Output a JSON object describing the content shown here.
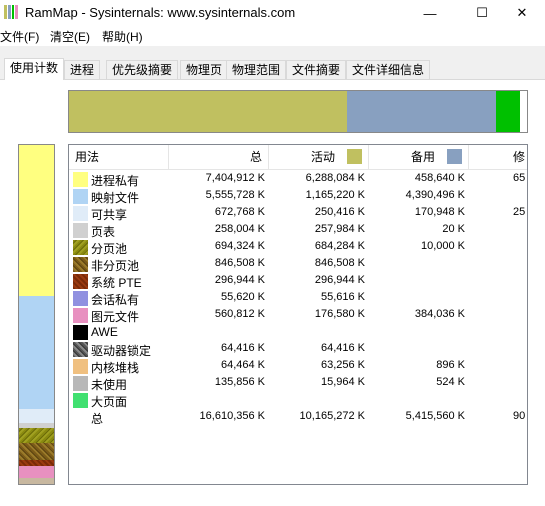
{
  "window": {
    "title": "RamMap - Sysinternals: www.sysinternals.com",
    "min_label": "—",
    "max_label": "☐",
    "close_label": "✕"
  },
  "menu": [
    {
      "label": "文件(F)"
    },
    {
      "label": "清空(E)"
    },
    {
      "label": "帮助(H)"
    }
  ],
  "tabs": [
    {
      "label": "使用计数",
      "active": true
    },
    {
      "label": "进程"
    },
    {
      "label": "优先级摘要"
    },
    {
      "label": "物理页"
    },
    {
      "label": "物理范围"
    },
    {
      "label": "文件摘要"
    },
    {
      "label": "文件详细信息"
    }
  ],
  "columns": {
    "usage": "用法",
    "total": "总",
    "active": "活动",
    "standby": "备用",
    "modified": "修"
  },
  "colors": {
    "active": "#c0c060",
    "standby": "#88a0c0",
    "modified": "#00c000"
  },
  "rows": [
    {
      "label": "进程私有",
      "total": "7,404,912 K",
      "active": "6,288,084 K",
      "standby": "458,640 K",
      "modified": "65"
    },
    {
      "label": "映射文件",
      "total": "5,555,728 K",
      "active": "1,165,220 K",
      "standby": "4,390,496 K",
      "modified": ""
    },
    {
      "label": "可共享",
      "total": "672,768 K",
      "active": "250,416 K",
      "standby": "170,948 K",
      "modified": "25"
    },
    {
      "label": "页表",
      "total": "258,004 K",
      "active": "257,984 K",
      "standby": "20 K",
      "modified": ""
    },
    {
      "label": "分页池",
      "total": "694,324 K",
      "active": "684,284 K",
      "standby": "10,000 K",
      "modified": ""
    },
    {
      "label": "非分页池",
      "total": "846,508 K",
      "active": "846,508 K",
      "standby": "",
      "modified": ""
    },
    {
      "label": "系统 PTE",
      "total": "296,944 K",
      "active": "296,944 K",
      "standby": "",
      "modified": ""
    },
    {
      "label": "会话私有",
      "total": "55,620 K",
      "active": "55,616 K",
      "standby": "",
      "modified": ""
    },
    {
      "label": "图元文件",
      "total": "560,812 K",
      "active": "176,580 K",
      "standby": "384,036 K",
      "modified": ""
    },
    {
      "label": "AWE",
      "total": "",
      "active": "",
      "standby": "",
      "modified": ""
    },
    {
      "label": "驱动器锁定",
      "total": "64,416 K",
      "active": "64,416 K",
      "standby": "",
      "modified": ""
    },
    {
      "label": "内核堆栈",
      "total": "64,464 K",
      "active": "63,256 K",
      "standby": "896 K",
      "modified": ""
    },
    {
      "label": "未使用",
      "total": "135,856 K",
      "active": "15,964 K",
      "standby": "524 K",
      "modified": ""
    },
    {
      "label": "大页面",
      "total": "",
      "active": "",
      "standby": "",
      "modified": ""
    },
    {
      "label": "总",
      "total": "16,610,356 K",
      "active": "10,165,272 K",
      "standby": "5,415,560 K",
      "modified": "90"
    }
  ],
  "hbar_segments": [
    {
      "name": "active",
      "fraction": 0.608,
      "color": "#c0c060"
    },
    {
      "name": "standby",
      "fraction": 0.325,
      "color": "#88a0c0"
    },
    {
      "name": "modified",
      "fraction": 0.052,
      "color": "#00c000"
    },
    {
      "name": "free",
      "fraction": 0.015,
      "color": "#ffffff"
    }
  ],
  "vbar_segments": [
    {
      "name": "process-private",
      "fraction": 0.446,
      "color": "#ffff80"
    },
    {
      "name": "mapped-file",
      "fraction": 0.334,
      "color": "#b0d4f4"
    },
    {
      "name": "shareable",
      "fraction": 0.04,
      "color": "#e0ecf8"
    },
    {
      "name": "page-table",
      "fraction": 0.016,
      "color": "#d0d0d0"
    },
    {
      "name": "paged-pool",
      "fraction": 0.042,
      "color": "#8a8a10"
    },
    {
      "name": "nonpaged-pool",
      "fraction": 0.051,
      "color": "#7a5a18"
    },
    {
      "name": "system-pte",
      "fraction": 0.018,
      "color": "#7a2a08"
    },
    {
      "name": "image-file",
      "fraction": 0.034,
      "color": "#e890c0"
    },
    {
      "name": "rest",
      "fraction": 0.019,
      "color": "#c8b8a0"
    }
  ]
}
